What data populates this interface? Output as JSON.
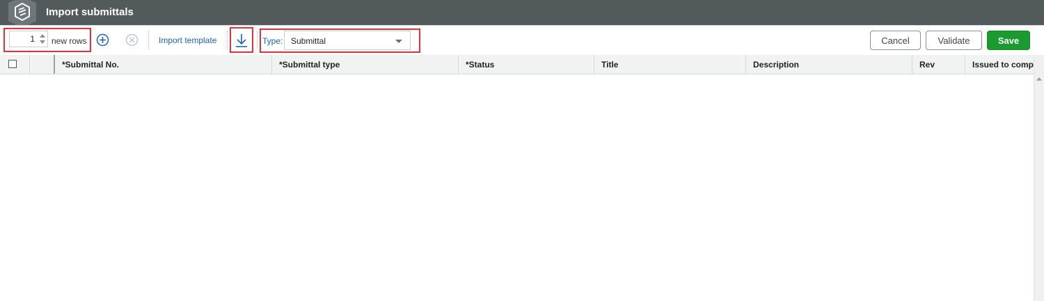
{
  "app": {
    "title": "Import submittals",
    "logo_icon": "procore-logo-icon"
  },
  "toolbar": {
    "rows_value": "1",
    "rows_label": "new rows",
    "add_icon": "plus-circle-icon",
    "remove_icon": "x-circle-icon",
    "import_template_label": "Import template",
    "download_icon": "download-icon",
    "type_label": "Type:",
    "type_value": "Submittal",
    "cancel_label": "Cancel",
    "validate_label": "Validate",
    "save_label": "Save"
  },
  "table": {
    "columns": [
      "*Submittal No.",
      "*Submittal type",
      "*Status",
      "Title",
      "Description",
      "Rev",
      "Issued to compa"
    ],
    "rows": []
  },
  "colors": {
    "titlebar": "#535a5c",
    "link": "#1a62b5",
    "highlight": "#e5303c",
    "save": "#1a9a2f"
  }
}
